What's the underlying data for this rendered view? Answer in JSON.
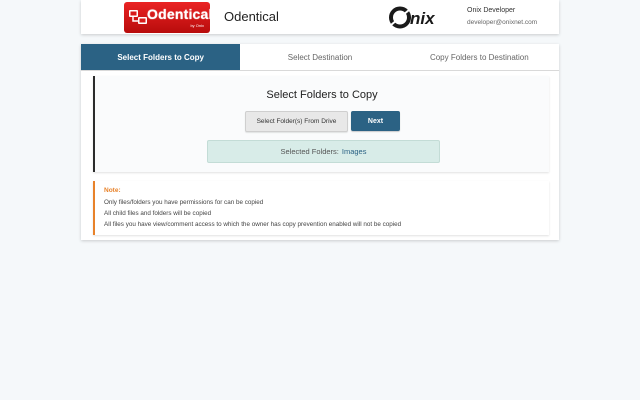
{
  "header": {
    "logo_word": "Odentical",
    "logo_byline": "by Onix",
    "app_title": "Odentical",
    "user_name": "Onix Developer",
    "user_email": "developer@onixnet.com"
  },
  "tabs": [
    {
      "label": "Select Folders to Copy",
      "active": true
    },
    {
      "label": "Select Destination",
      "active": false
    },
    {
      "label": "Copy Folders to Destination",
      "active": false
    }
  ],
  "step": {
    "heading": "Select Folders to Copy",
    "select_button": "Select Folder(s) From Drive",
    "next_button": "Next",
    "selected_label": "Selected Folders:",
    "selected_value": "Images"
  },
  "note": {
    "title": "Note:",
    "lines": [
      "Only files/folders you have permissions for can be copied",
      "All child files and folders will be copied",
      "All files you have view/comment access to which the owner has copy prevention enabled will not be copied"
    ]
  },
  "colors": {
    "accent": "#2b6284",
    "logo_red": "#d81b1b",
    "note_orange": "#e8822a",
    "selected_bg": "#d8ece8"
  }
}
